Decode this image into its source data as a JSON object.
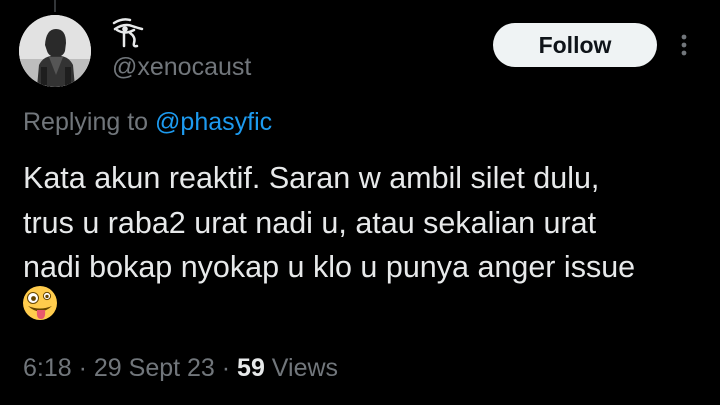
{
  "author": {
    "handle": "@xenocaust",
    "avatar_icon": "bw-photo-person-avatar",
    "display_name_icon": "eye-of-horus-glyph-icon"
  },
  "follow_button": {
    "label": "Follow"
  },
  "more_icon": "more-vertical-icon",
  "reply": {
    "prefix": "Replying to ",
    "mention": "@phasyfic"
  },
  "tweet": {
    "lines": [
      "Kata akun reaktif. Saran w ambil silet dulu,",
      "trus u raba2 urat nadi u, atau sekalian urat",
      "nadi bokap nyokap u klo u punya anger issue"
    ],
    "emoji_icon": "zany-face-emoji"
  },
  "meta": {
    "time": "6:18",
    "separator": " · ",
    "date": "29 Sept 23",
    "views_count": "59",
    "views_label": " Views"
  },
  "colors": {
    "background": "#000000",
    "text_primary": "#e7e9ea",
    "text_secondary": "#71767b",
    "mention_blue": "#1d9bf0",
    "follow_bg": "#eff3f4"
  }
}
